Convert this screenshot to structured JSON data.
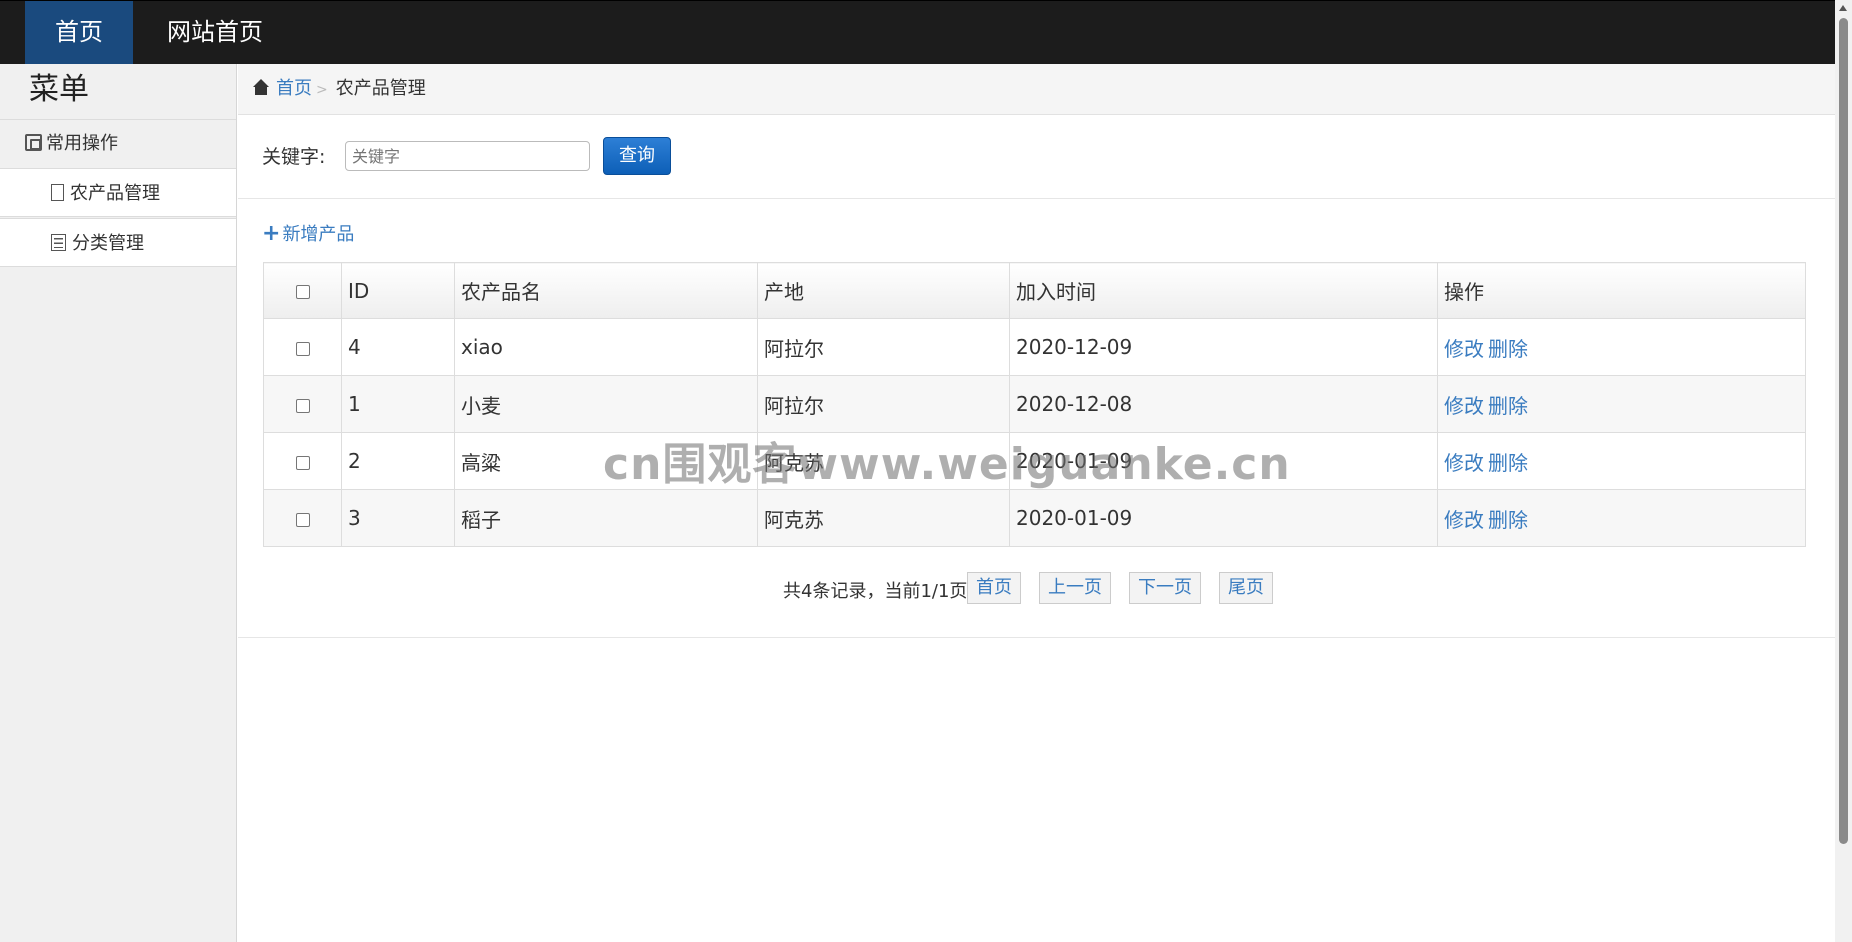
{
  "topbar": {
    "home": "首页",
    "site_home": "网站首页"
  },
  "sidebar": {
    "title": "菜单",
    "group_label": "常用操作",
    "items": [
      {
        "label": "农产品管理"
      },
      {
        "label": "分类管理"
      }
    ]
  },
  "breadcrumb": {
    "home": "首页",
    "separator": ">",
    "current": "农产品管理"
  },
  "search": {
    "label": "关键字:",
    "placeholder": "关键字",
    "button": "查询"
  },
  "add_button": {
    "icon": "+",
    "label": "新增产品"
  },
  "table": {
    "headers": [
      "ID",
      "农产品名",
      "产地",
      "加入时间",
      "操作"
    ],
    "rows": [
      {
        "id": "4",
        "name": "xiao",
        "origin": "阿拉尔",
        "date": "2020-12-09"
      },
      {
        "id": "1",
        "name": "小麦",
        "origin": "阿拉尔",
        "date": "2020-12-08"
      },
      {
        "id": "2",
        "name": "高粱",
        "origin": "阿克苏",
        "date": "2020-01-09"
      },
      {
        "id": "3",
        "name": "稻子",
        "origin": "阿克苏",
        "date": "2020-01-09"
      }
    ],
    "edit_label": "修改",
    "delete_label": "删除"
  },
  "pager": {
    "info": "共4条记录，当前1/1页",
    "first": "首页",
    "prev": "上一页",
    "next": "下一页",
    "last": "尾页"
  },
  "watermark": "cn围观客www.weiguanke.cn",
  "colors": {
    "topbar_bg": "#1c1c1c",
    "active_nav": "#1a4a7e",
    "link": "#3a7cc0",
    "primary_button": "#0d5fb7"
  }
}
